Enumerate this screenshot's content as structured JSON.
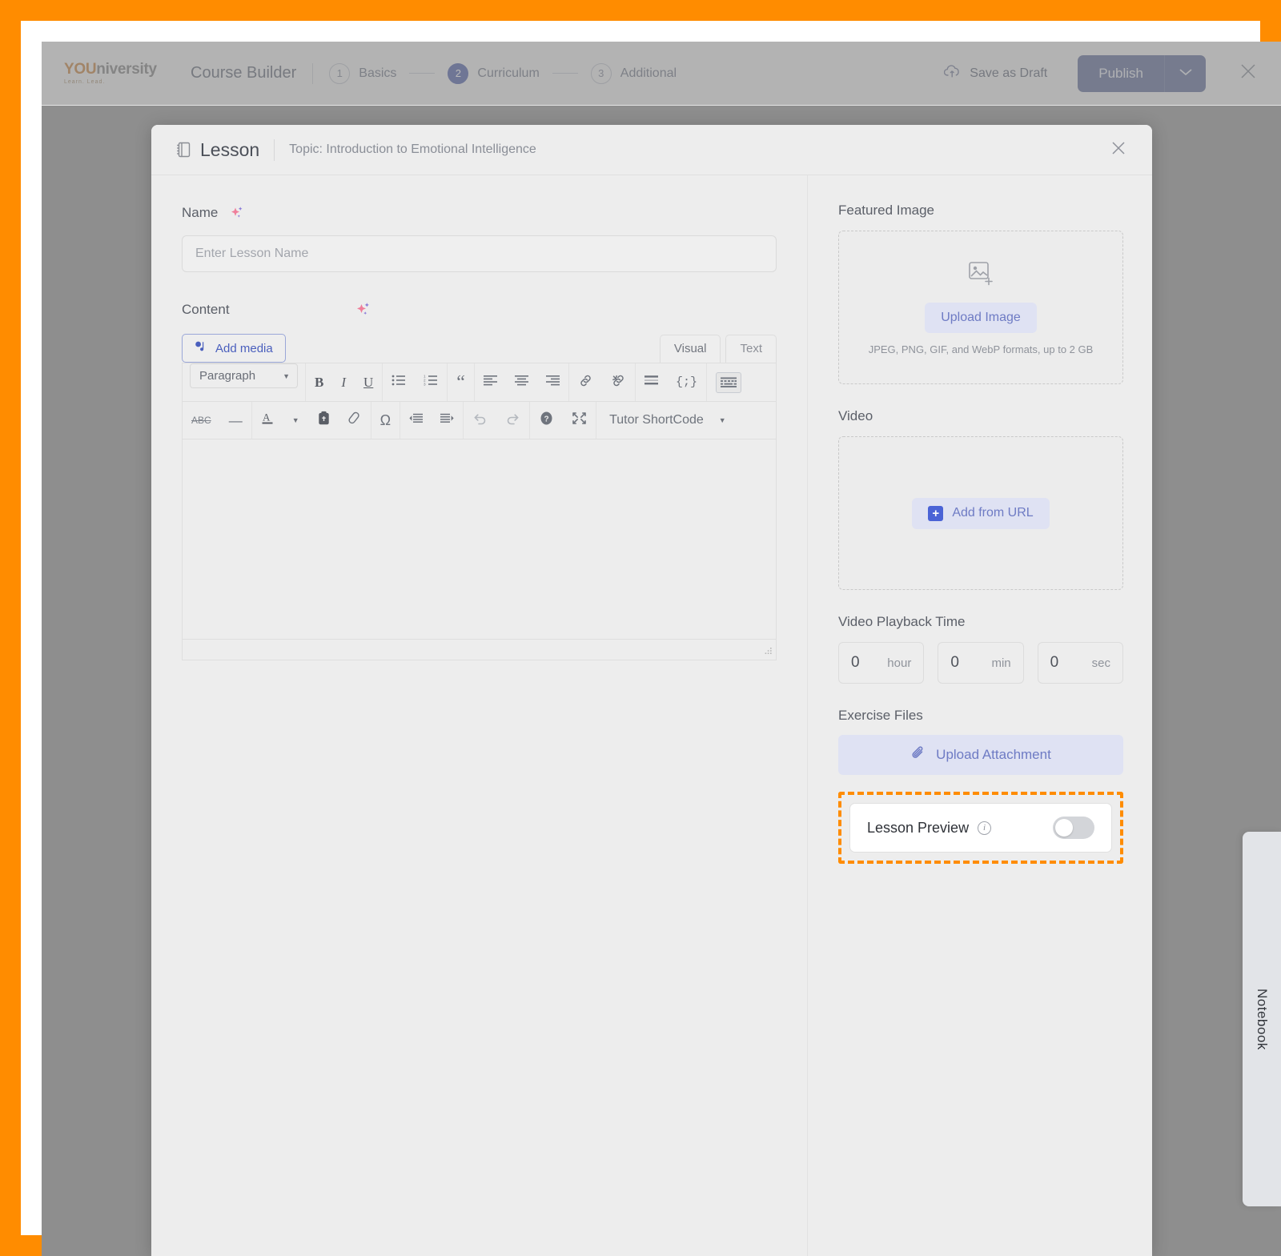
{
  "topbar": {
    "logo_main": "YOU",
    "logo_rest": "niversity",
    "logo_sub": "Learn. Lead.",
    "course_builder_title": "Course Builder",
    "steps": [
      {
        "number": "1",
        "label": "Basics",
        "active": false
      },
      {
        "number": "2",
        "label": "Curriculum",
        "active": true
      },
      {
        "number": "3",
        "label": "Additional",
        "active": false
      }
    ],
    "save_draft_label": "Save as Draft",
    "publish_label": "Publish",
    "publish_caret_icon": "chevron-down-icon",
    "close_icon": "close-icon"
  },
  "modal": {
    "icon": "lesson-book-icon",
    "title": "Lesson",
    "topic": "Topic: Introduction to Emotional Intelligence",
    "close_icon": "close-icon"
  },
  "left": {
    "name_label": "Name",
    "name_ai_icon": "ai-sparkle-icon",
    "name_placeholder": "Enter Lesson Name",
    "name_value": "",
    "content_label": "Content",
    "content_ai_icon": "ai-sparkle-icon",
    "add_media_label": "Add media",
    "add_media_icon": "media-icon",
    "tabs": [
      {
        "label": "Visual",
        "active": true
      },
      {
        "label": "Text",
        "active": false
      }
    ],
    "toolbar_row1": {
      "format_select": "Paragraph",
      "buttons": [
        {
          "name": "bold-icon",
          "glyph": "B"
        },
        {
          "name": "italic-icon",
          "glyph": "I"
        },
        {
          "name": "underline-icon",
          "glyph": "U"
        },
        {
          "name": "bulleted-list-icon",
          "glyph": "☰"
        },
        {
          "name": "numbered-list-icon",
          "glyph": "☰"
        },
        {
          "name": "blockquote-icon",
          "glyph": "“"
        },
        {
          "name": "align-left-icon",
          "glyph": "≡"
        },
        {
          "name": "align-center-icon",
          "glyph": "≡"
        },
        {
          "name": "align-right-icon",
          "glyph": "≡"
        },
        {
          "name": "insert-link-icon",
          "glyph": "🔗"
        },
        {
          "name": "remove-link-icon",
          "glyph": "🔗"
        },
        {
          "name": "read-more-icon",
          "glyph": "≡"
        },
        {
          "name": "code-snippet-icon",
          "glyph": "{;}"
        },
        {
          "name": "toolbar-toggle-icon",
          "glyph": "⌨"
        }
      ]
    },
    "toolbar_row2": {
      "buttons": [
        {
          "name": "strikethrough-icon",
          "glyph": "ABC"
        },
        {
          "name": "horizontal-rule-icon",
          "glyph": "—"
        },
        {
          "name": "text-color-icon",
          "glyph": "A"
        },
        {
          "name": "paste-as-text-icon",
          "glyph": "📋"
        },
        {
          "name": "clear-formatting-icon",
          "glyph": "⊘"
        },
        {
          "name": "special-character-icon",
          "glyph": "Ω"
        },
        {
          "name": "decrease-indent-icon",
          "glyph": "≡"
        },
        {
          "name": "increase-indent-icon",
          "glyph": "≡"
        },
        {
          "name": "undo-icon",
          "glyph": "↶"
        },
        {
          "name": "redo-icon",
          "glyph": "↷"
        },
        {
          "name": "keyboard-shortcuts-icon",
          "glyph": "?"
        },
        {
          "name": "fullscreen-icon",
          "glyph": "⤢"
        }
      ],
      "shortcode_label": "Tutor ShortCode",
      "shortcode_caret": "caret-down-icon"
    },
    "editor_content": ""
  },
  "right": {
    "featured_image": {
      "label": "Featured Image",
      "icon": "add-image-icon",
      "button_label": "Upload Image",
      "hint": "JPEG, PNG, GIF, and WebP formats, up to 2 GB"
    },
    "video": {
      "label": "Video",
      "button_icon": "plus-square-icon",
      "button_label": "Add from URL"
    },
    "playback": {
      "label": "Video Playback Time",
      "fields": [
        {
          "value": "0",
          "unit": "hour"
        },
        {
          "value": "0",
          "unit": "min"
        },
        {
          "value": "0",
          "unit": "sec"
        }
      ]
    },
    "exercise_files": {
      "label": "Exercise Files",
      "button_icon": "paperclip-icon",
      "button_label": "Upload Attachment"
    },
    "lesson_preview": {
      "label": "Lesson Preview",
      "info_icon": "info-icon",
      "toggle_state": "off",
      "highlight_color": "#ff8c00"
    }
  },
  "notebook_tab": {
    "label": "Notebook"
  },
  "colors": {
    "accent_orange": "#ff8c00",
    "publish_blue": "#6b779f",
    "step_active": "#5b6ab0",
    "soft_button_bg": "#dfe2f3",
    "soft_button_text": "#6e7bc4"
  }
}
